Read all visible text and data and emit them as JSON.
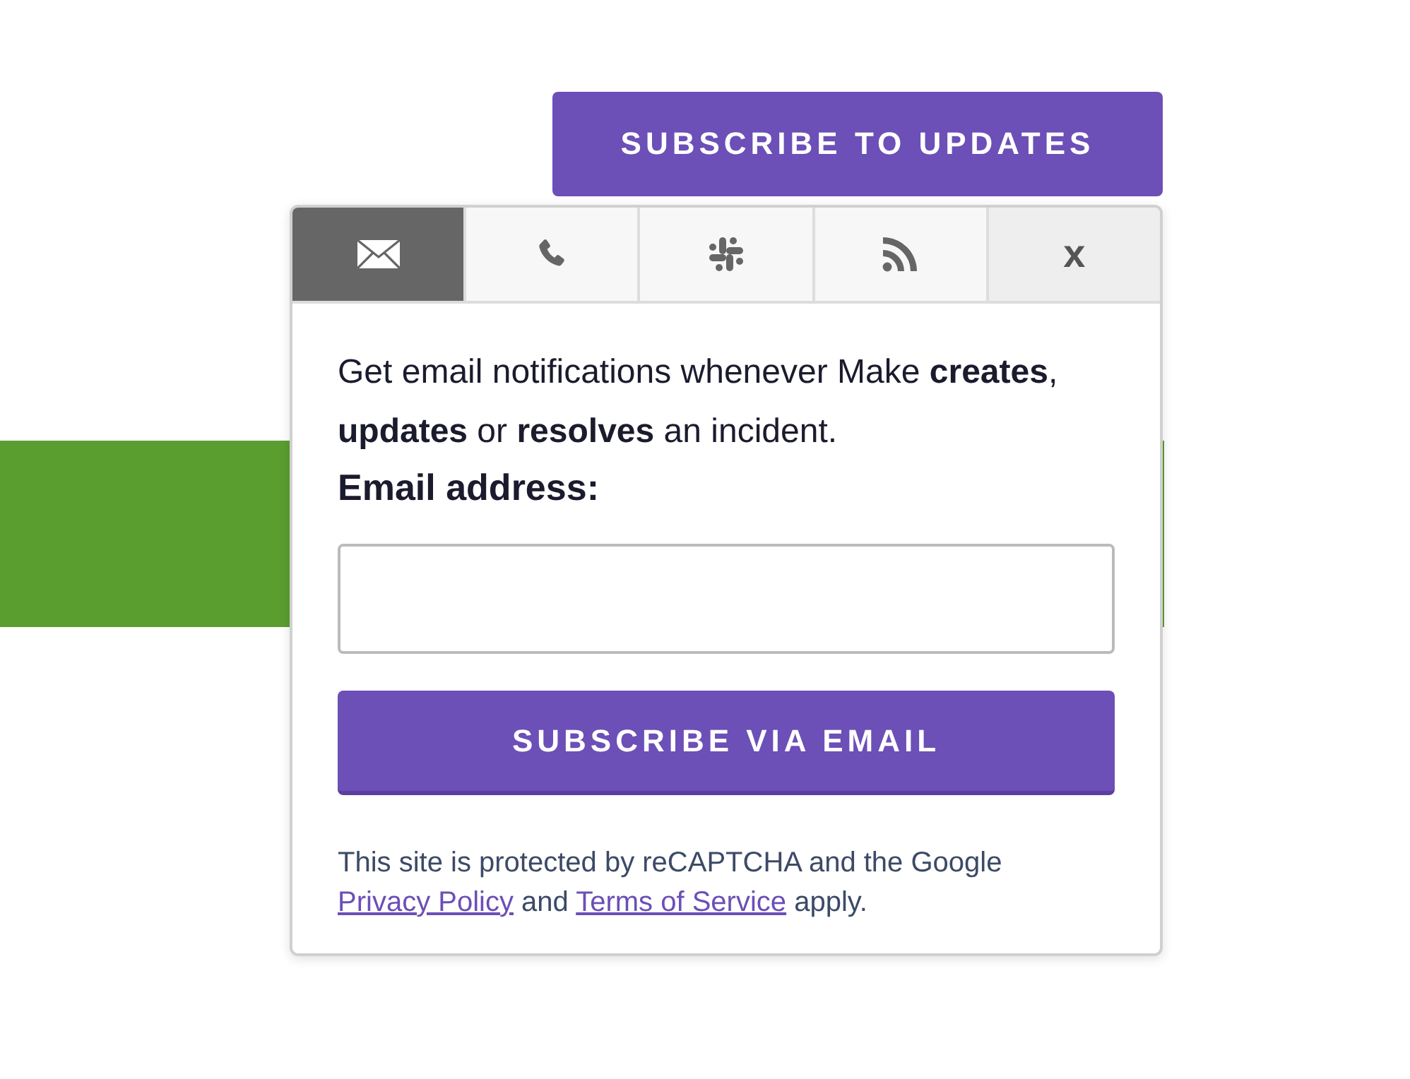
{
  "subscribe_button": "SUBSCRIBE TO UPDATES",
  "popup": {
    "tabs": [
      {
        "kind": "email",
        "selected": true
      },
      {
        "kind": "phone",
        "selected": false
      },
      {
        "kind": "slack",
        "selected": false
      },
      {
        "kind": "rss",
        "selected": false
      },
      {
        "kind": "close",
        "label": "x",
        "selected": false
      }
    ],
    "description": "Get email notifications whenever Make **creates**, **updates** or **resolves** an incident.",
    "field_label": "Email address:",
    "submit_button": "SUBSCRIBE VIA EMAIL",
    "footer": [
      {
        "kind": "text",
        "text": "This site is protected by reCAPTCHA and the Google "
      },
      {
        "kind": "link",
        "text": "Privacy Policy"
      },
      {
        "kind": "text",
        "text": " and "
      },
      {
        "kind": "link",
        "text": "Terms of Service"
      },
      {
        "kind": "text",
        "text": " apply."
      }
    ]
  }
}
